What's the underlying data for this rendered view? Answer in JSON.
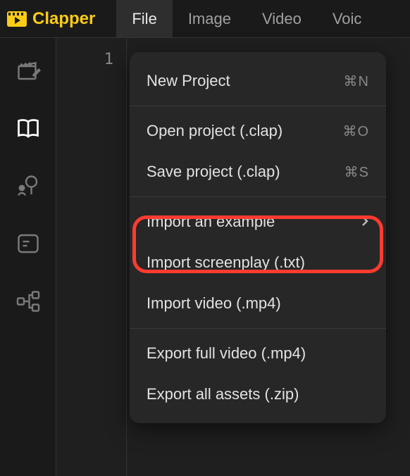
{
  "app": {
    "name": "Clapper"
  },
  "menubar": {
    "items": [
      {
        "label": "File",
        "active": true
      },
      {
        "label": "Image",
        "active": false
      },
      {
        "label": "Video",
        "active": false
      },
      {
        "label": "Voic",
        "active": false
      }
    ]
  },
  "sidebar": {
    "items": [
      {
        "name": "clapper-edit-icon"
      },
      {
        "name": "book-icon"
      },
      {
        "name": "person-tree-icon"
      },
      {
        "name": "panel-icon"
      },
      {
        "name": "graph-icon"
      }
    ]
  },
  "editor": {
    "line_number": "1"
  },
  "dropdown": {
    "groups": [
      [
        {
          "label": "New Project",
          "shortcut": "⌘N",
          "submenu": false
        }
      ],
      [
        {
          "label": "Open project (.clap)",
          "shortcut": "⌘O",
          "submenu": false
        },
        {
          "label": "Save project (.clap)",
          "shortcut": "⌘S",
          "submenu": false
        }
      ],
      [
        {
          "label": "Import an example",
          "shortcut": "",
          "submenu": true,
          "highlighted": true
        },
        {
          "label": "Import screenplay (.txt)",
          "shortcut": "",
          "submenu": false
        },
        {
          "label": "Import video (.mp4)",
          "shortcut": "",
          "submenu": false
        }
      ],
      [
        {
          "label": "Export full video (.mp4)",
          "shortcut": "",
          "submenu": false
        },
        {
          "label": "Export all assets (.zip)",
          "shortcut": "",
          "submenu": false
        }
      ]
    ]
  },
  "colors": {
    "accent": "#facc15",
    "highlight": "#ff3b30"
  }
}
